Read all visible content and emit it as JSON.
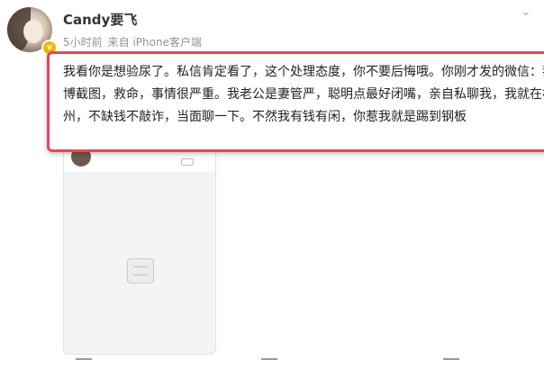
{
  "post": {
    "username": "Candy要飞",
    "verified_badge": "v",
    "time": "5小时前",
    "source": "来自 iPhone客户端",
    "text": "我看你是想验尿了。私信肯定看了，这个处理态度，你不要后悔哦。你刚才发的微信：我微博截图，救命，事情很严重。我老公是妻管严，聪明点最好闭嘴，亲自私聊我，我就在杭州，不缺钱不敲诈，当面聊一下。不然我有钱有闲，你惹我就是踢到钢板"
  },
  "colors": {
    "highlight_border": "#e8455c",
    "meta_text": "#939393",
    "badge": "#f7b500"
  },
  "icons": [
    "avatar",
    "verified-badge-icon",
    "more-icon",
    "empty-content-icon"
  ]
}
